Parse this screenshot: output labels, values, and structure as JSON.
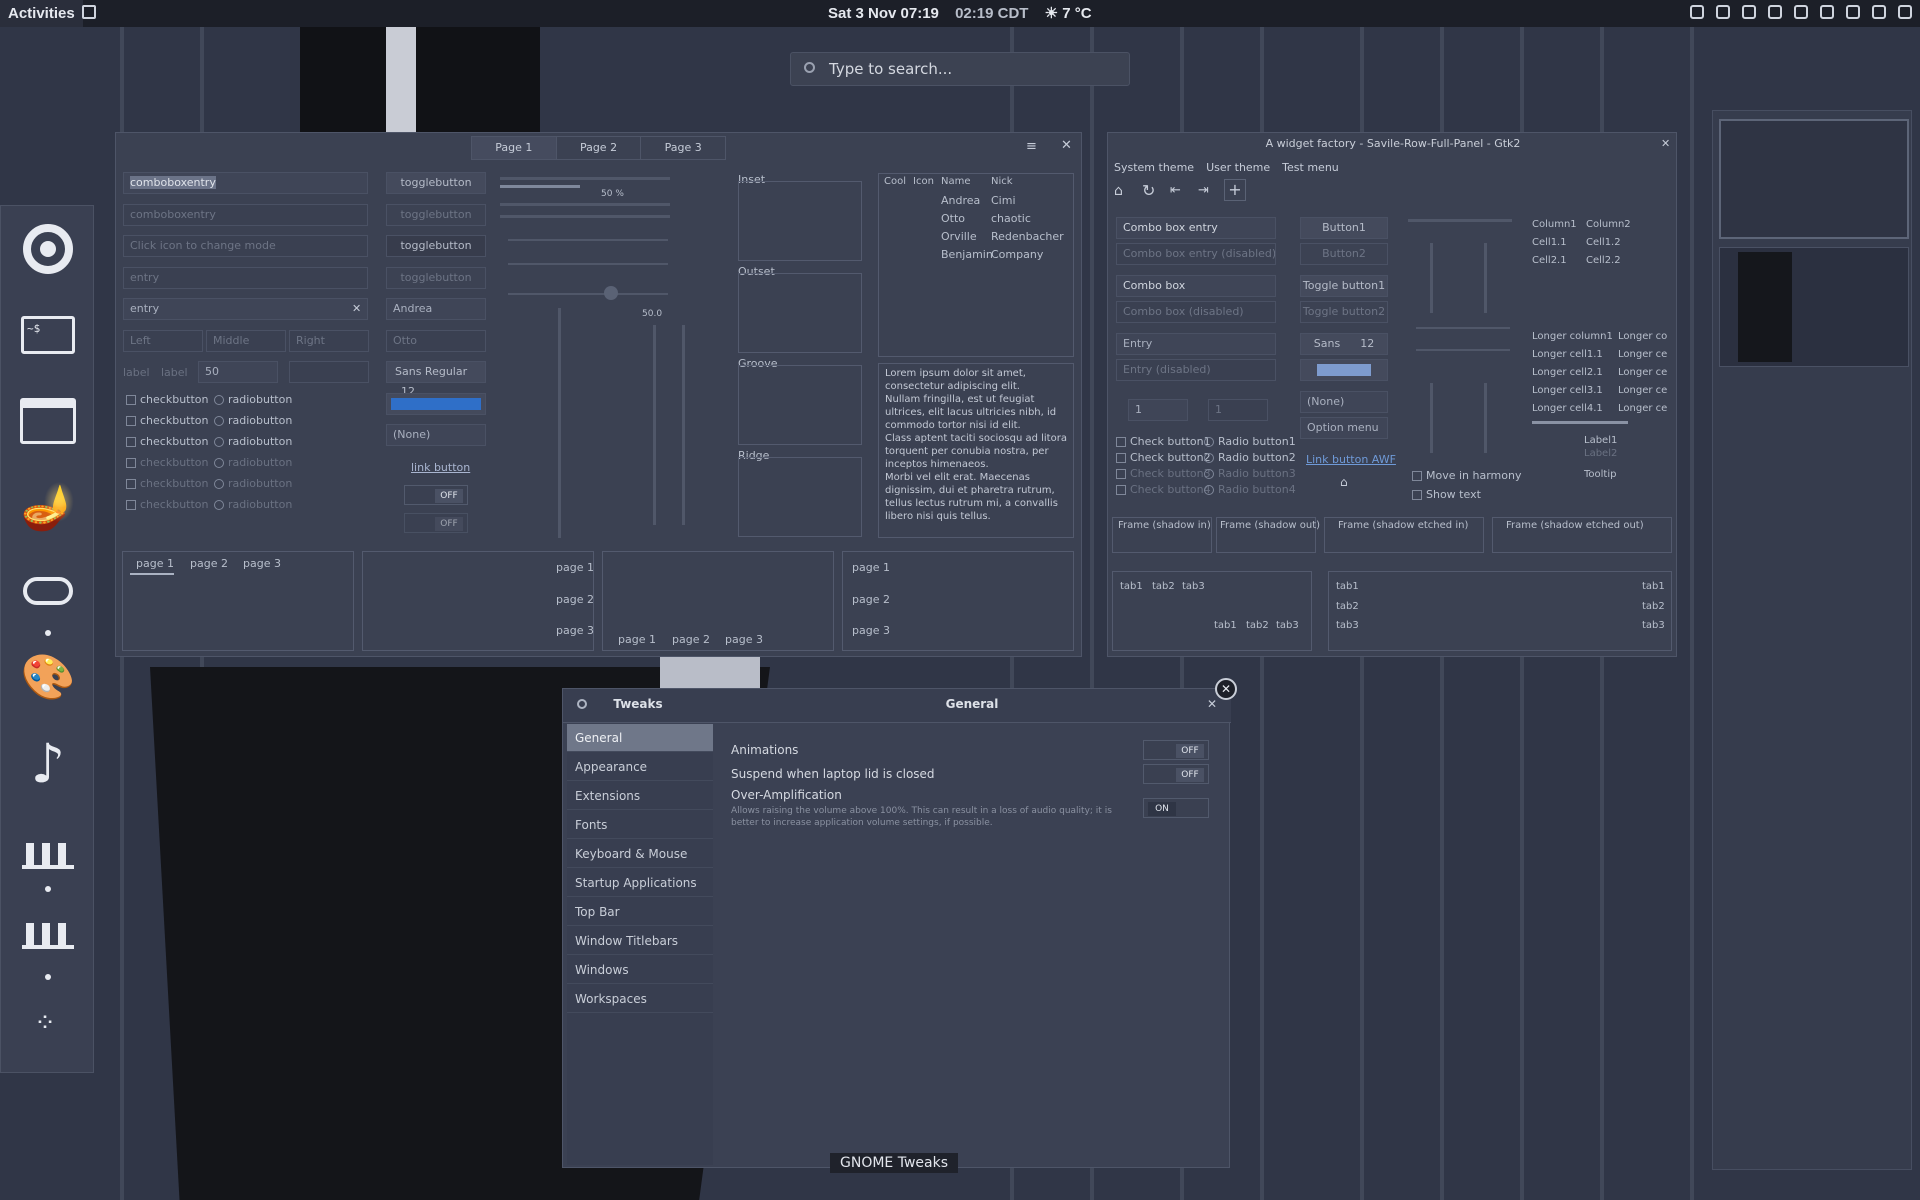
{
  "topbar": {
    "activities": "Activities",
    "date": "Sat 3 Nov",
    "time": "07:19",
    "alt_time": "02:19 CDT",
    "weather": "7 °C"
  },
  "search": {
    "placeholder": "Type to search..."
  },
  "dash": {
    "apps": [
      "chrome-icon",
      "terminal-icon",
      "files-icon",
      "aladdin-lamp-icon",
      "game-controller-icon",
      "paint-palette-icon",
      "music-note-icon",
      "widget-factory-icon",
      "widget-factory-2-icon",
      "show-apps-icon"
    ],
    "terminal_prompt": "~$"
  },
  "gtk3": {
    "tabs": [
      "Page 1",
      "Page 2",
      "Page 3"
    ],
    "comboboxentry": "comboboxentry",
    "comboboxentry_disabled": "comboboxentry",
    "click_icon": "Click icon to change mode",
    "entry_placeholder": "entry",
    "entry": "entry",
    "align": [
      "Left",
      "Middle",
      "Right"
    ],
    "label1": "label",
    "label2": "label",
    "spin": "50",
    "togglebuttons": [
      "togglebutton",
      "togglebutton",
      "togglebutton",
      "togglebutton"
    ],
    "combo_andrea": "Andrea",
    "combo_otto": "Otto",
    "font": "Sans Regular",
    "font_size": "12",
    "file_none": "(None)",
    "link": "link button",
    "off": "OFF",
    "check": "checkbutton",
    "radio": "radiobutton",
    "progress_pct": "50 %",
    "scale_val": "50.0",
    "frames": [
      "Inset",
      "Outset",
      "Groove",
      "Ridge"
    ],
    "tree_headers": [
      "Cool",
      "Icon",
      "Name",
      "Nick"
    ],
    "tree_rows": [
      {
        "name": "Andrea",
        "nick": "Cimi"
      },
      {
        "name": "Otto",
        "nick": "chaotic"
      },
      {
        "name": "Orville",
        "nick": "Redenbacher"
      },
      {
        "name": "Benjamin",
        "nick": "Company"
      }
    ],
    "lorem": "Lorem ipsum dolor sit amet, consectetur adipiscing elit.\nNullam fringilla, est ut feugiat ultrices, elit lacus ultricies nibh, id commodo tortor nisi id elit.\nClass aptent taciti sociosqu ad litora torquent per conubia nostra, per inceptos himenaeos.\nMorbi vel elit erat. Maecenas dignissim, dui et pharetra rutrum, tellus lectus rutrum mi, a convallis libero nisi quis tellus.",
    "nb_pages": [
      "page 1",
      "page 2",
      "page 3"
    ]
  },
  "gtk2": {
    "title": "A widget factory - Savile-Row-Full-Panel - Gtk2",
    "menu": [
      "System theme",
      "User theme",
      "Test menu"
    ],
    "combo_entry": "Combo box entry",
    "combo_entry_dis": "Combo box entry (disabled)",
    "combo": "Combo box",
    "combo_dis": "Combo box (disabled)",
    "entry": "Entry",
    "entry_dis": "Entry (disabled)",
    "spin1": "1",
    "spin2": "1",
    "button1": "Button1",
    "button2": "Button2",
    "toggle1": "Toggle button1",
    "toggle2": "Toggle button2",
    "font": "Sans",
    "font_size": "12",
    "none": "(None)",
    "option": "Option menu",
    "link": "Link button AWF",
    "checks": [
      "Check button1",
      "Check button2",
      "Check button3",
      "Check button4"
    ],
    "radios": [
      "Radio button1",
      "Radio button2",
      "Radio button3",
      "Radio button4"
    ],
    "move": "Move in harmony",
    "showtext": "Show text",
    "columns": [
      "Column1",
      "Column2"
    ],
    "cells": [
      [
        "Cell1.1",
        "Cell1.2"
      ],
      [
        "Cell2.1",
        "Cell2.2"
      ]
    ],
    "long_cols": [
      "Longer column1",
      "Longer co"
    ],
    "long_cells": [
      [
        "Longer cell1.1",
        "Longer ce"
      ],
      [
        "Longer cell2.1",
        "Longer ce"
      ],
      [
        "Longer cell3.1",
        "Longer ce"
      ],
      [
        "Longer cell4.1",
        "Longer ce"
      ]
    ],
    "label1": "Label1",
    "label2": "Label2",
    "tooltip": "Tooltip",
    "frames": [
      "Frame (shadow in)",
      "Frame (shadow out)",
      "Frame (shadow etched in)",
      "Frame (shadow etched out)"
    ],
    "tabs": [
      "tab1",
      "tab2",
      "tab3"
    ]
  },
  "tweaks": {
    "app": "Tweaks",
    "page": "General",
    "sidebar": [
      "General",
      "Appearance",
      "Extensions",
      "Fonts",
      "Keyboard & Mouse",
      "Startup Applications",
      "Top Bar",
      "Window Titlebars",
      "Windows",
      "Workspaces"
    ],
    "animations": "Animations",
    "suspend": "Suspend when laptop lid is closed",
    "over": "Over-Amplification",
    "over_desc": "Allows raising the volume above 100%. This can result in a loss of audio quality; it is better to increase application volume settings, if possible.",
    "off": "OFF",
    "on": "ON",
    "caption": "GNOME Tweaks"
  }
}
